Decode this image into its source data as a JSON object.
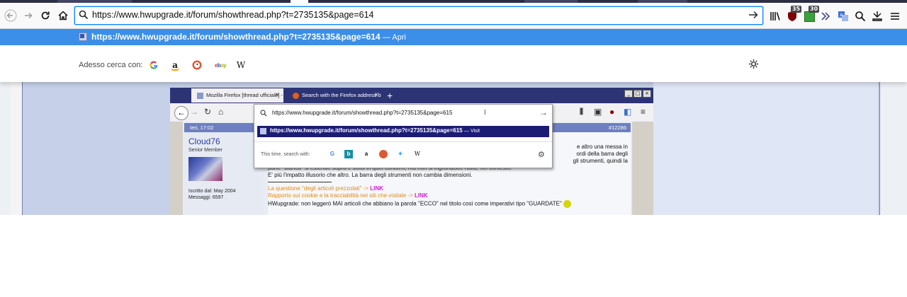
{
  "toolbar": {
    "url": "https://www.hwupgrade.it/forum/showthread.php?t=2735135&page=614",
    "ublock_badge": "35",
    "ext_badge": "30"
  },
  "suggestion": {
    "url": "https://www.hwupgrade.it/forum/showthread.php?t=2735135&page=614",
    "action": "— Apri"
  },
  "engines": {
    "label": "Adesso cerca con:",
    "items": [
      "G",
      "a",
      "ebay",
      "W"
    ]
  },
  "embedded": {
    "tab1": "Mozilla Firefox [thread ufficiale] -",
    "tab2": "Search with the Firefox address b",
    "popup": {
      "url_text": "https://www.hwupgrade.it/forum/showthread.php?t=2735135&page=615",
      "suggestion_url": "https://www.hwupgrade.it/forum/showthread.php?t=2735135&page=615",
      "suggestion_action": "— Visit",
      "search_label": "This time, search with:",
      "engines": [
        "G",
        "b",
        "a",
        "W"
      ]
    },
    "post": {
      "date": "Ieri, 17:02",
      "number": "#12286",
      "username": "Cloud76",
      "usertitle": "Senior Member",
      "joined": "Iscritto dal: May 2004",
      "messages": "Messaggi: 6597",
      "line1": "e altro una messa in",
      "line2": "ordi della barra degli",
      "line3": "gli strumenti, quindi la",
      "line4": "parte \"bianca\" si estende sopra e sotto in quei contorni, ma non si ingrandisce nulla, nel contesto.",
      "line5": "E' più l'impatto illusorio che altro. La barra degli strumenti non cambia dimensioni.",
      "sig1": "La questione \"degli articoli prezzolati\" ->",
      "sig1_link": "LINK",
      "sig2": "Rapporto sui cookie e la tracciabilità nei siti che visitate ->",
      "sig2_link": "LINK",
      "sig3": "HWupgrade: non leggerò MAI articoli che abbiano la parola \"ECCO\" nel titolo così come imperativi tipo \"GUARDATE\""
    }
  },
  "colors": {
    "accent": "#0a84ff",
    "suggestion_bg": "#3b8fe8",
    "forum_frame": "#c6d0e8"
  }
}
